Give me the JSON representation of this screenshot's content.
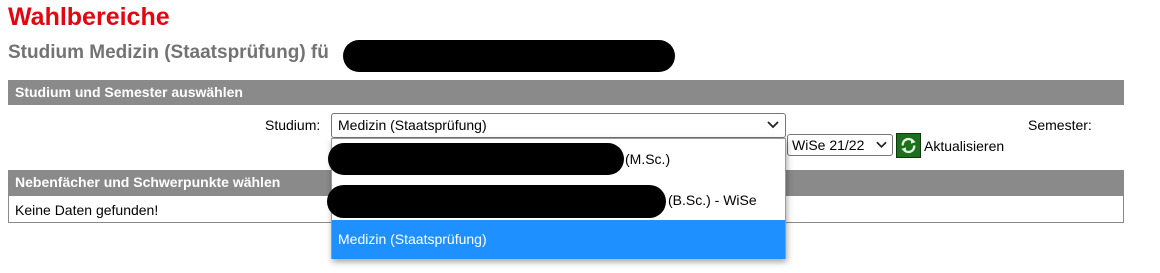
{
  "page": {
    "title": "Wahlbereiche",
    "subtitle": "Studium Medizin (Staatsprüfung) fü"
  },
  "section_select": {
    "header": "Studium und Semester auswählen",
    "studium_label": "Studium:",
    "studium_value": "Medizin (Staatsprüfung)",
    "semester_label": "Semester:",
    "semester_value": "WiSe 21/22",
    "refresh_label": "Aktualisieren"
  },
  "dropdown": {
    "options": [
      {
        "label": "(M.Sc.)",
        "redacted": true
      },
      {
        "label": "(B.Sc.) - WiSe",
        "redacted": true
      },
      {
        "label": "Medizin (Staatsprüfung)",
        "selected": true
      }
    ]
  },
  "section_nebenfaecher": {
    "header": "Nebenfächer und Schwerpunkte wählen",
    "empty_text": "Keine Daten gefunden!"
  },
  "colors": {
    "title": "#e4050f",
    "subtitle": "#737373",
    "section_header_bg": "#8a8a8a",
    "option_selected_bg": "#1e90ff",
    "refresh_icon": "#145a14"
  }
}
